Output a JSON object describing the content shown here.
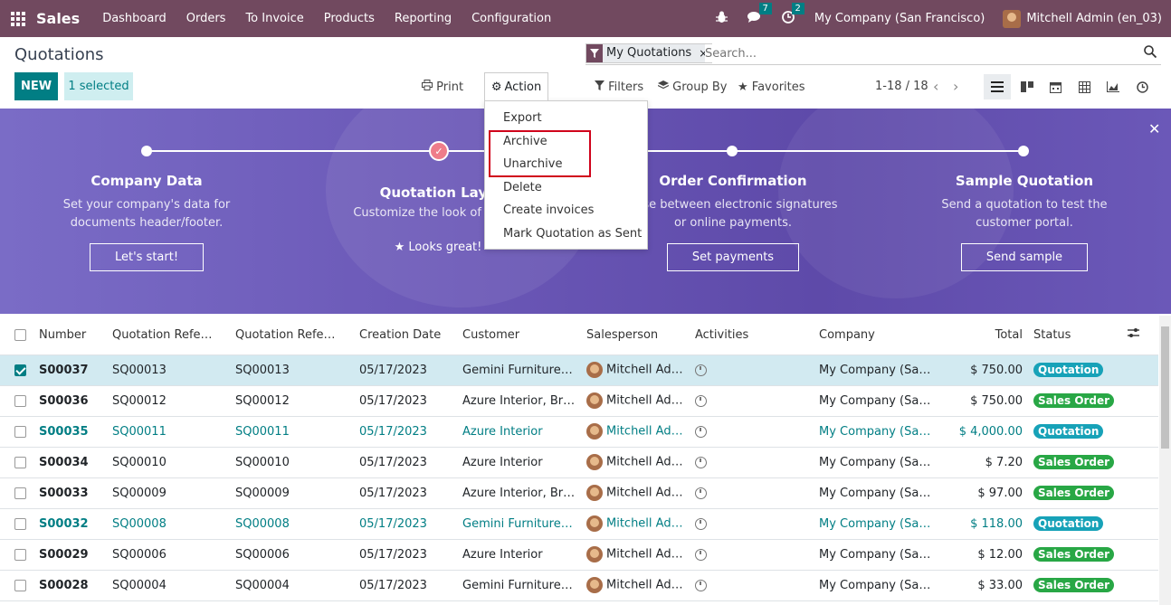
{
  "navbar": {
    "brand": "Sales",
    "menu": [
      "Dashboard",
      "Orders",
      "To Invoice",
      "Products",
      "Reporting",
      "Configuration"
    ],
    "chat_count": "7",
    "activity_count": "2",
    "company": "My Company (San Francisco)",
    "user": "Mitchell Admin (en_03)"
  },
  "control": {
    "title": "Quotations",
    "new_label": "NEW",
    "selected_label": "1 selected",
    "print_label": "Print",
    "action_label": "Action",
    "facet_label": "My Quotations",
    "search_placeholder": "Search...",
    "filters_label": "Filters",
    "groupby_label": "Group By",
    "favorites_label": "Favorites",
    "pager": "1-18 / 18"
  },
  "action_menu": [
    "Export",
    "Archive",
    "Unarchive",
    "Delete",
    "Create invoices",
    "Mark Quotation as Sent"
  ],
  "banner": {
    "steps": [
      {
        "title": "Company Data",
        "desc": "Set your company's data for documents header/footer.",
        "button": "Let's start!"
      },
      {
        "title": "Quotation Layo",
        "desc": "Customize the look of your q",
        "button": "Looks great!"
      },
      {
        "title": "Order Confirmation",
        "desc": "oose between electronic signatures or online payments.",
        "button": "Set payments"
      },
      {
        "title": "Sample Quotation",
        "desc": "Send a quotation to test the customer portal.",
        "button": "Send sample"
      }
    ]
  },
  "table": {
    "headers": [
      "Number",
      "Quotation Refe…",
      "Quotation Refe…",
      "Creation Date",
      "Customer",
      "Salesperson",
      "Activities",
      "Company",
      "Total",
      "Status"
    ],
    "rows": [
      {
        "number": "S00037",
        "ref1": "SQ00013",
        "ref2": "SQ00013",
        "date": "05/17/2023",
        "customer": "Gemini Furniture, S…",
        "salesperson": "Mitchell Admin",
        "company": "My Company (San F…",
        "total": "$ 750.00",
        "status": "Quotation"
      },
      {
        "number": "S00036",
        "ref1": "SQ00012",
        "ref2": "SQ00012",
        "date": "05/17/2023",
        "customer": "Azure Interior, Bran…",
        "salesperson": "Mitchell Admin",
        "company": "My Company (San F…",
        "total": "$ 750.00",
        "status": "Sales Order"
      },
      {
        "number": "S00035",
        "ref1": "SQ00011",
        "ref2": "SQ00011",
        "date": "05/17/2023",
        "customer": "Azure Interior",
        "salesperson": "Mitchell Admin",
        "company": "My Company (San F…",
        "total": "$ 4,000.00",
        "status": "Quotation"
      },
      {
        "number": "S00034",
        "ref1": "SQ00010",
        "ref2": "SQ00010",
        "date": "05/17/2023",
        "customer": "Azure Interior",
        "salesperson": "Mitchell Admin",
        "company": "My Company (San F…",
        "total": "$ 7.20",
        "status": "Sales Order"
      },
      {
        "number": "S00033",
        "ref1": "SQ00009",
        "ref2": "SQ00009",
        "date": "05/17/2023",
        "customer": "Azure Interior, Bran…",
        "salesperson": "Mitchell Admin",
        "company": "My Company (San F…",
        "total": "$ 97.00",
        "status": "Sales Order"
      },
      {
        "number": "S00032",
        "ref1": "SQ00008",
        "ref2": "SQ00008",
        "date": "05/17/2023",
        "customer": "Gemini Furniture, S…",
        "salesperson": "Mitchell Admin",
        "company": "My Company (San F…",
        "total": "$ 118.00",
        "status": "Quotation"
      },
      {
        "number": "S00029",
        "ref1": "SQ00006",
        "ref2": "SQ00006",
        "date": "05/17/2023",
        "customer": "Azure Interior",
        "salesperson": "Mitchell Admin",
        "company": "My Company (San F…",
        "total": "$ 12.00",
        "status": "Sales Order"
      },
      {
        "number": "S00028",
        "ref1": "SQ00004",
        "ref2": "SQ00004",
        "date": "05/17/2023",
        "customer": "Gemini Furniture, S…",
        "salesperson": "Mitchell Admin",
        "company": "My Company (San F…",
        "total": "$ 33.00",
        "status": "Sales Order"
      }
    ]
  },
  "colors": {
    "navbar": "#71495f",
    "primary": "#017e84",
    "quotation_badge": "#17a2b8",
    "sales_order_badge": "#28a745",
    "highlight": "#d0021b"
  }
}
